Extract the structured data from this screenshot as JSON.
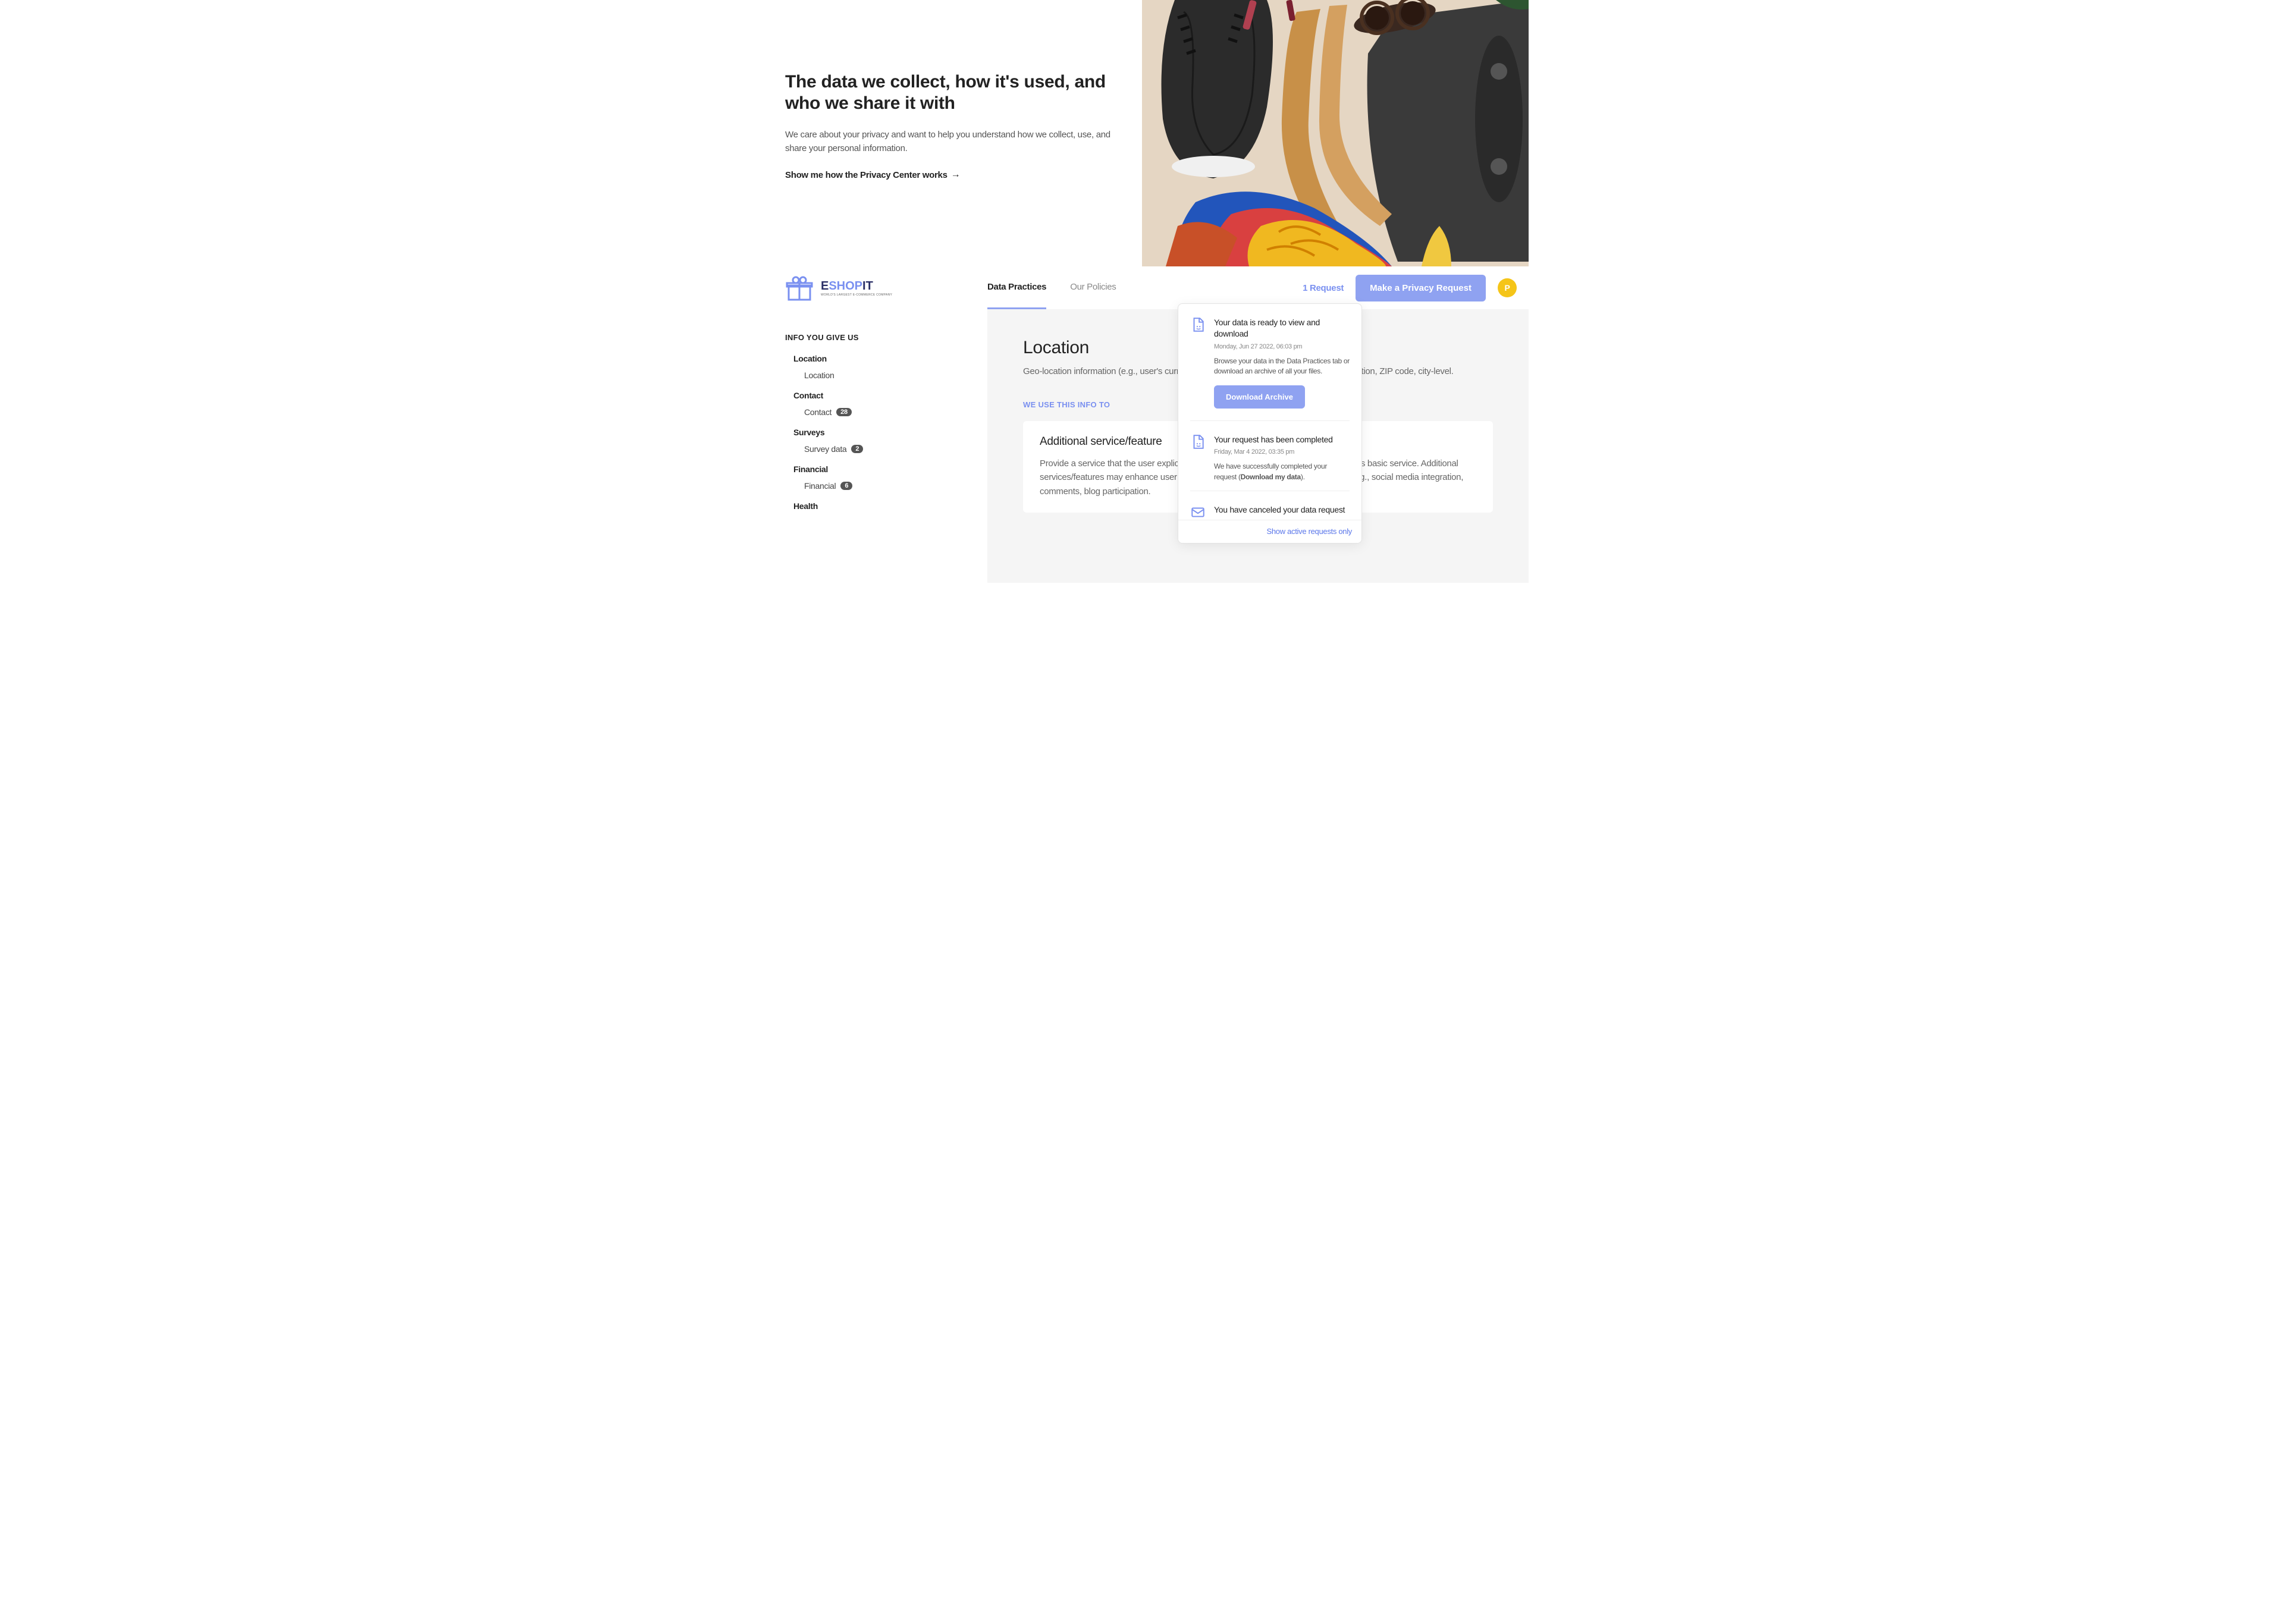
{
  "hero": {
    "title": "The data we collect, how it's used, and who we share it with",
    "body": "We care about your privacy and want to help you understand how we collect, use, and share your personal information.",
    "link": "Show me how the Privacy Center works",
    "arrow": "→"
  },
  "logo": {
    "e": "E",
    "shop": "SHOP",
    "it": "IT",
    "sub": "WORLD'S LARGEST E-COMMERCE COMPANY"
  },
  "tabs": {
    "practices": "Data Practices",
    "policies": "Our Policies"
  },
  "nav": {
    "request_link": "1 Request",
    "make_button": "Make a Privacy Request",
    "avatar_letter": "P"
  },
  "sidebar": {
    "header": "INFO YOU GIVE US",
    "groups": [
      {
        "label": "Location",
        "items": [
          {
            "label": "Location",
            "badge": null
          }
        ]
      },
      {
        "label": "Contact",
        "items": [
          {
            "label": "Contact",
            "badge": "28"
          }
        ]
      },
      {
        "label": "Surveys",
        "items": [
          {
            "label": "Survey data",
            "badge": "2"
          }
        ]
      },
      {
        "label": "Financial",
        "items": [
          {
            "label": "Financial",
            "badge": "6"
          }
        ]
      },
      {
        "label": "Health",
        "items": []
      }
    ]
  },
  "main": {
    "title": "Location",
    "desc": "Geo-location information (e.g., user's current location), general vicinity (e.g., real-time location, ZIP code, city-level.",
    "use_header": "WE USE THIS INFO TO",
    "card": {
      "title": "Additional service/feature",
      "body": "Provide a service that the user explicitly requests and that is part of the product's/app's basic service. Additional services/features may enhance user experience but are not part of additional data, e.g., social media integration, comments, blog participation."
    }
  },
  "dropdown": {
    "items": [
      {
        "icon": "file",
        "title": "Your data is ready to view and download",
        "date": "Monday, Jun 27 2022, 06:03 pm",
        "text_pre": "Browse your data in the Data Practices tab or download an archive of all your files.",
        "button": "Download Archive"
      },
      {
        "icon": "file",
        "title": "Your request has been completed",
        "date": "Friday, Mar 4 2022, 03:35 pm",
        "text_pre": "We have successfully completed your request (",
        "text_bold": "Download my data",
        "text_post": ")."
      },
      {
        "icon": "mail",
        "title": "You have canceled your data request"
      }
    ],
    "footer": "Show active requests only"
  }
}
